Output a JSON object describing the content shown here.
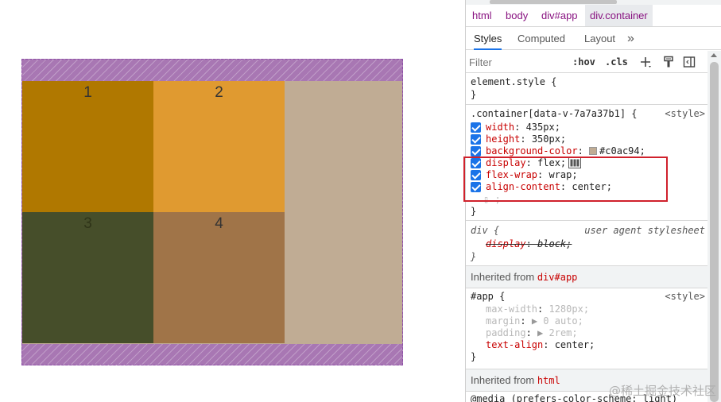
{
  "demo": {
    "items": [
      "1",
      "2",
      "3",
      "4"
    ]
  },
  "breadcrumbs": [
    "html",
    "body",
    "div#app",
    "div.container"
  ],
  "tabs": [
    "Styles",
    "Computed",
    "Layout"
  ],
  "toolbar": {
    "filter_placeholder": "Filter",
    "hov": ":hov",
    "cls": ".cls"
  },
  "rules": {
    "element_style": {
      "selector": "element.style {",
      "close": "}"
    },
    "container": {
      "selector": ".container[data-v-7a7a37b1] {",
      "source": "<style>",
      "props": [
        {
          "name": "width",
          "value": "435px;"
        },
        {
          "name": "height",
          "value": "350px;"
        },
        {
          "name": "background-color",
          "value": "#c0ac94;"
        },
        {
          "name": "display",
          "value": "flex;"
        },
        {
          "name": "flex-wrap",
          "value": "wrap;"
        },
        {
          "name": "align-content",
          "value": "center;"
        }
      ],
      "close": "}"
    },
    "div_ua": {
      "selector": "div {",
      "source": "user agent stylesheet",
      "prop": "display",
      "value": "block;",
      "close": "}"
    },
    "inherited_app": {
      "label": "Inherited from",
      "tag": "div#app"
    },
    "app": {
      "selector": "#app {",
      "source": "<style>",
      "props": [
        {
          "name": "max-width",
          "value": "1280px;"
        },
        {
          "name": "margin",
          "value": "0 auto;"
        },
        {
          "name": "padding",
          "value": "2rem;"
        },
        {
          "name": "text-align",
          "value": "center;"
        }
      ],
      "close": "}"
    },
    "inherited_html": {
      "label": "Inherited from",
      "tag": "html"
    },
    "media": "@media (prefers-color-scheme: light)"
  },
  "watermark": "@稀土掘金技术社区",
  "colors": {
    "container_bg": "#c0ac94",
    "item1": "#b07800",
    "item2": "#e09a30",
    "item3": "#464e2a",
    "item4": "#a07448",
    "accent": "#1a73e8",
    "highlight": "#d0212c"
  }
}
